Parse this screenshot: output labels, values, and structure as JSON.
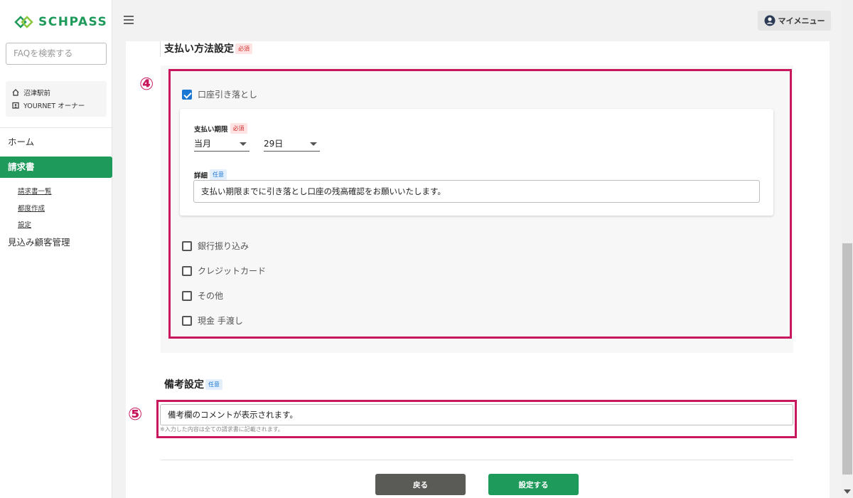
{
  "sidebar": {
    "logo_text": "SCHPASS",
    "search_placeholder": "FAQを検索する",
    "info": {
      "school": "沼津駅前",
      "role": "YOURNET オーナー"
    },
    "nav": {
      "home": "ホーム",
      "invoice": "請求書",
      "prospect": "見込み顧客管理"
    },
    "sub": [
      "請求書一覧",
      "都度作成",
      "設定"
    ]
  },
  "header": {
    "my_menu": "マイメニュー"
  },
  "payment": {
    "title": "支払い方法設定",
    "required": "必須",
    "optional": "任意",
    "marker_4": "④",
    "bank_debit": {
      "label": "口座引き落とし",
      "checked": true
    },
    "deadline_label": "支払い期限",
    "deadline_month": "当月",
    "deadline_day": "29日",
    "detail_label": "詳細",
    "detail_value": "支払い期限までに引き落とし口座の残高確認をお願いいたします。",
    "options": [
      {
        "label": "銀行振り込み",
        "checked": false
      },
      {
        "label": "クレジットカード",
        "checked": false
      },
      {
        "label": "その他",
        "checked": false
      },
      {
        "label": "現金 手渡し",
        "checked": false
      }
    ]
  },
  "remarks": {
    "title": "備考設定",
    "optional": "任意",
    "marker_5": "⑤",
    "value": "備考欄のコメントが表示されます。",
    "hint": "※入力した内容は全ての請求書に記載されます。"
  },
  "actions": {
    "back": "戻る",
    "save": "設定する"
  },
  "colors": {
    "brand": "#1e9a5a",
    "highlight": "#c8175d",
    "checkbox": "#1976d2"
  }
}
